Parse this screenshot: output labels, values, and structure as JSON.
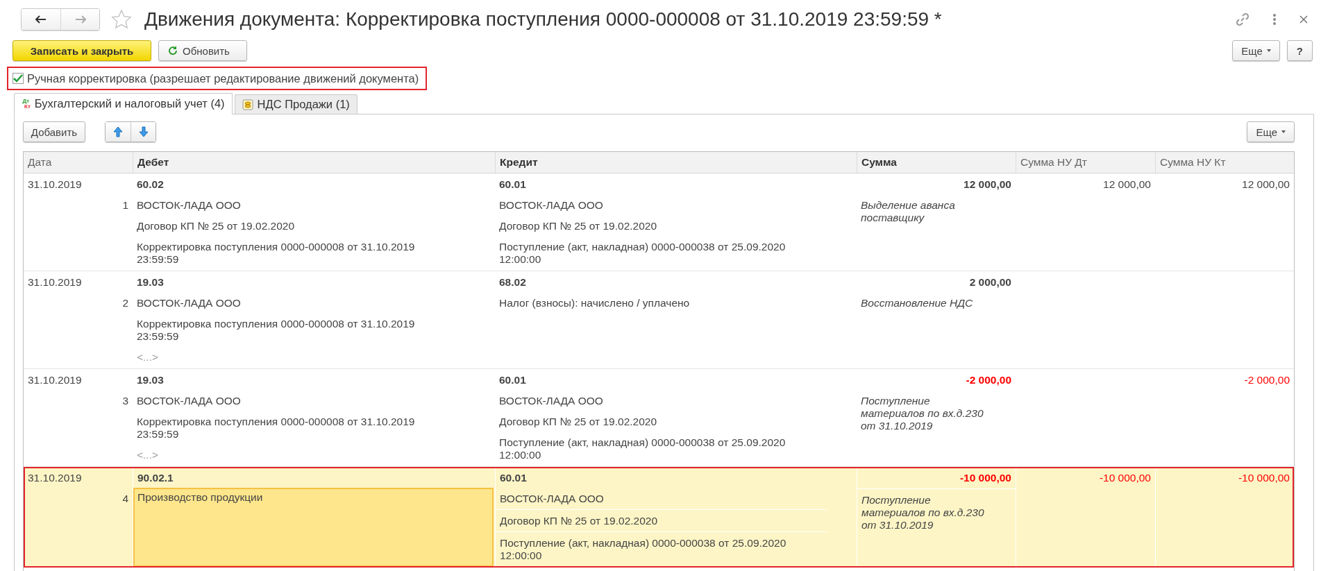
{
  "window": {
    "title": "Движения документа: Корректировка поступления 0000-000008 от 31.10.2019 23:59:59 *",
    "favorite": false
  },
  "toolbar": {
    "primary": "Записать и закрыть",
    "refresh": "Обновить",
    "more": "Еще",
    "help": "?"
  },
  "manual_edit": {
    "label": "Ручная корректировка (разрешает редактирование движений документа)",
    "checked": true,
    "outlined": true
  },
  "tabs": [
    {
      "label": "Бухгалтерский и налоговый учет (4)",
      "selected": true,
      "kind": "dtkt",
      "icon_top": "Дт",
      "icon_bottom": "Кт"
    },
    {
      "label": "НДС Продажи (1)",
      "selected": false,
      "kind": "register"
    }
  ],
  "table_toolbar": {
    "add": "Добавить",
    "more": "Еще"
  },
  "table": {
    "columns": [
      {
        "label": "Дата",
        "bold": false
      },
      {
        "label": "Дебет",
        "bold": true
      },
      {
        "label": "Кредит",
        "bold": true
      },
      {
        "label": "Сумма",
        "bold": true
      },
      {
        "label": "Сумма НУ Дт",
        "bold": false
      },
      {
        "label": "Сумма НУ Кт",
        "bold": false
      }
    ],
    "rows": [
      {
        "date": "31.10.2019",
        "number": "1",
        "selected": false,
        "outlined": false,
        "debit": {
          "account": "60.02",
          "focused": false,
          "lines": [
            {
              "kind": "value",
              "text": "ВОСТОК-ЛАДА ООО"
            },
            {
              "kind": "value",
              "text": "Договор КП № 25 от 19.02.2020"
            },
            {
              "kind": "value",
              "text": "Корректировка поступления 0000-000008 от 31.10.2019 23:59:59"
            }
          ]
        },
        "credit": {
          "account": "60.01",
          "focused": false,
          "lines": [
            {
              "kind": "value",
              "text": "ВОСТОК-ЛАДА ООО"
            },
            {
              "kind": "value",
              "text": "Договор КП № 25 от 19.02.2020"
            },
            {
              "kind": "value",
              "text": "Поступление (акт, накладная) 0000-000038 от 25.09.2020 12:00:00"
            }
          ]
        },
        "amount": {
          "text": "12 000,00",
          "negative": false
        },
        "comment": "Выделение аванса поставщику",
        "tax_debit": {
          "text": "12 000,00",
          "negative": false
        },
        "tax_credit": {
          "text": "12 000,00",
          "negative": false
        }
      },
      {
        "date": "31.10.2019",
        "number": "2",
        "selected": false,
        "outlined": false,
        "debit": {
          "account": "19.03",
          "focused": false,
          "lines": [
            {
              "kind": "value",
              "text": "ВОСТОК-ЛАДА ООО"
            },
            {
              "kind": "value",
              "text": "Корректировка поступления 0000-000008 от 31.10.2019 23:59:59"
            },
            {
              "kind": "empty",
              "text": "<...>"
            }
          ]
        },
        "credit": {
          "account": "68.02",
          "focused": false,
          "lines": [
            {
              "kind": "value",
              "text": "Налог (взносы): начислено / уплачено"
            }
          ]
        },
        "amount": {
          "text": "2 000,00",
          "negative": false
        },
        "comment": "Восстановление НДС"
      },
      {
        "date": "31.10.2019",
        "number": "3",
        "selected": false,
        "outlined": false,
        "debit": {
          "account": "19.03",
          "focused": false,
          "lines": [
            {
              "kind": "value",
              "text": "ВОСТОК-ЛАДА ООО"
            },
            {
              "kind": "value",
              "text": "Корректировка поступления 0000-000008 от 31.10.2019 23:59:59"
            },
            {
              "kind": "empty",
              "text": "<...>"
            }
          ]
        },
        "credit": {
          "account": "60.01",
          "focused": false,
          "lines": [
            {
              "kind": "value",
              "text": "ВОСТОК-ЛАДА ООО"
            },
            {
              "kind": "value",
              "text": "Договор КП № 25 от 19.02.2020"
            },
            {
              "kind": "value",
              "text": "Поступление (акт, накладная) 0000-000038 от 25.09.2020 12:00:00"
            }
          ]
        },
        "amount": {
          "text": "-2 000,00",
          "negative": true
        },
        "comment": "Поступление материалов по вх.д.230 от 31.10.2019",
        "tax_credit": {
          "text": "-2 000,00",
          "negative": true
        }
      },
      {
        "date": "31.10.2019",
        "number": "4",
        "selected": true,
        "outlined": true,
        "debit": {
          "account": "90.02.1",
          "focused": true,
          "lines": [
            {
              "kind": "value",
              "text": "Производство продукции"
            }
          ]
        },
        "credit": {
          "account": "60.01",
          "focused": false,
          "lines": [
            {
              "kind": "value",
              "text": "ВОСТОК-ЛАДА ООО"
            },
            {
              "kind": "value",
              "text": "Договор КП № 25 от 19.02.2020"
            },
            {
              "kind": "value",
              "text": "Поступление (акт, накладная) 0000-000038 от 25.09.2020 12:00:00"
            }
          ]
        },
        "amount": {
          "text": "-10 000,00",
          "negative": true
        },
        "comment": "Поступление материалов по вх.д.230 от 31.10.2019",
        "tax_debit": {
          "text": "-10 000,00",
          "negative": true
        },
        "tax_credit": {
          "text": "-10 000,00",
          "negative": true
        }
      }
    ]
  }
}
